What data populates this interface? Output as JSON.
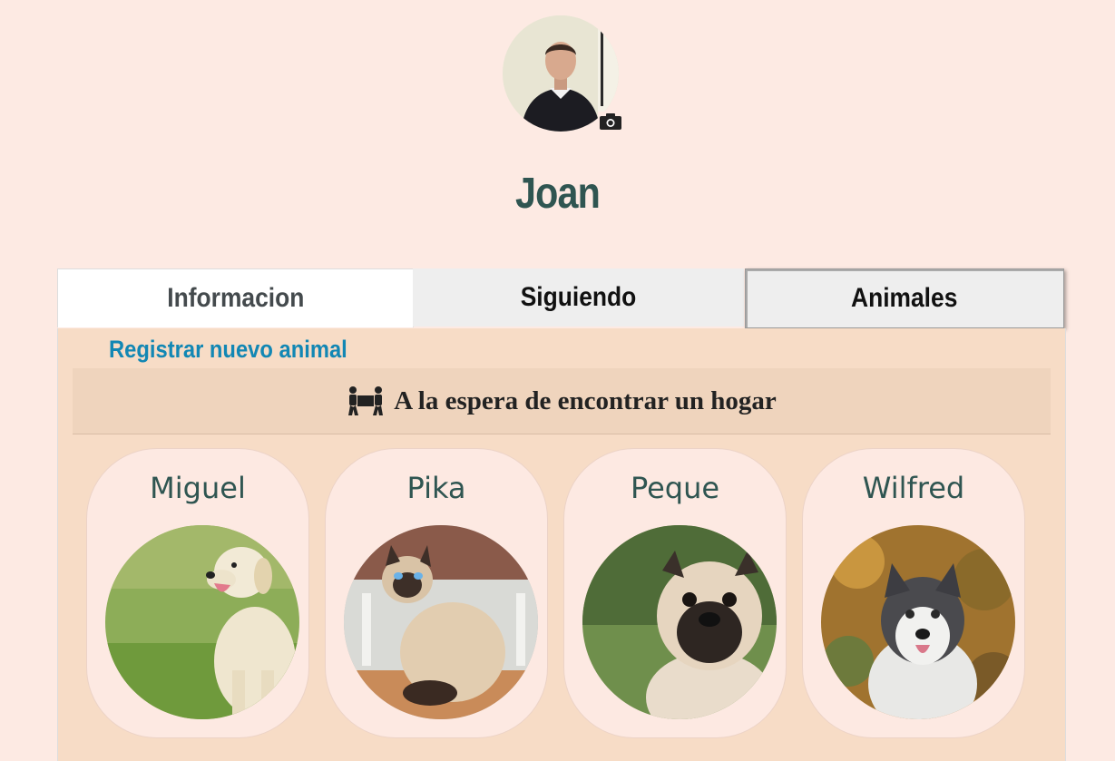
{
  "profile": {
    "name": "Joan",
    "avatar_icon": "user-photo",
    "camera_icon": "camera-icon"
  },
  "tabs": [
    {
      "label": "Informacion"
    },
    {
      "label": "Siguiendo"
    },
    {
      "label": "Animales"
    }
  ],
  "animals_section": {
    "register_link": "Registrar nuevo animal",
    "header_title": "A la espera de encontrar un hogar",
    "header_icon": "people-carrying-box-icon",
    "animals": [
      {
        "name": "Miguel",
        "photo": "golden-retriever-photo"
      },
      {
        "name": "Pika",
        "photo": "siamese-cat-photo"
      },
      {
        "name": "Peque",
        "photo": "pug-photo"
      },
      {
        "name": "Wilfred",
        "photo": "husky-photo"
      }
    ]
  },
  "colors": {
    "background": "#fdeae3",
    "name_color": "#2f5551",
    "link_color": "#1287b4",
    "panel_bg": "#f7dcc6",
    "card_bg": "#fde9e2"
  }
}
